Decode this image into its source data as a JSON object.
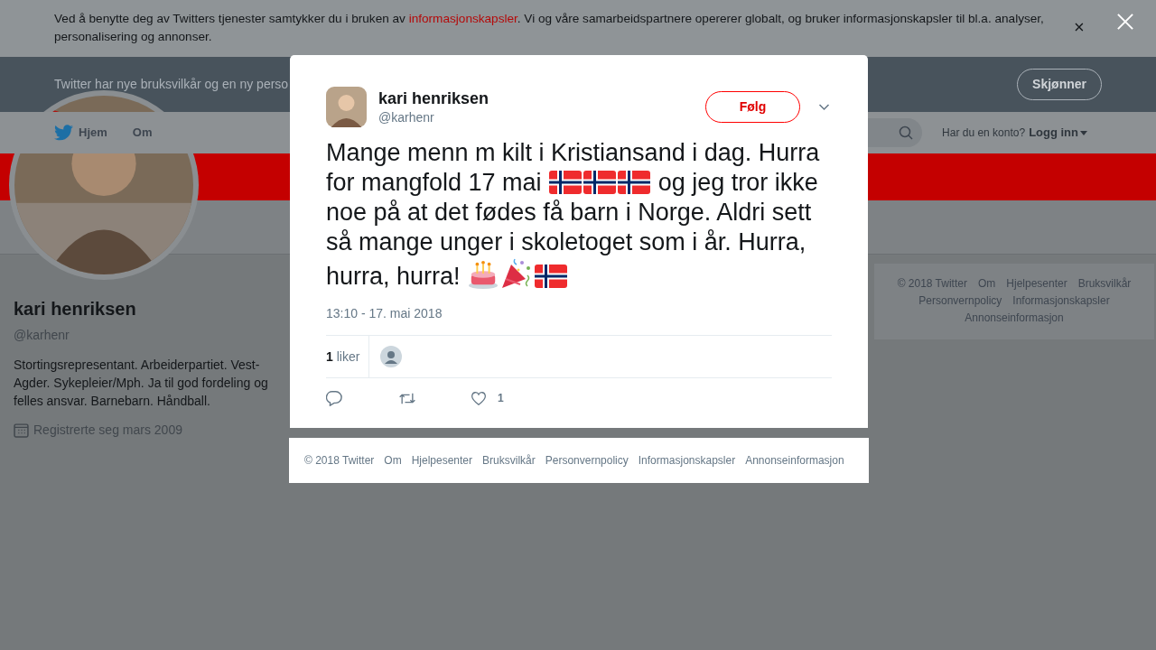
{
  "cookie_banner": {
    "text_before": "Ved å benytte deg av Twitters tjenester samtykker du i bruken av ",
    "link": "informasjonskapsler",
    "text_after": ". Vi og våre samarbeidspartnere opererer globalt, og bruker informasjonskapsler til bl.a. analyser, personalisering og annonser."
  },
  "terms_banner": {
    "text": "Twitter har nye bruksvilkår og en ny perso",
    "button": "Skjønner"
  },
  "nav": {
    "items": [
      "Hjem",
      "Om"
    ],
    "account_prompt": "Har du en konto?",
    "login": "Logg inn"
  },
  "profile": {
    "name": "kari henriksen",
    "handle": "@karhenr",
    "bio": "Stortingsrepresentant. Arbeiderpartiet. Vest-Agder. Sykepleier/Mph. Ja til god fordeling og felles ansvar. Barnebarn. Håndball.",
    "joined": "Registrerte seg mars 2009"
  },
  "side_footer": [
    "© 2018 Twitter",
    "Om",
    "Hjelpesenter",
    "Bruksvilkår",
    "Personvernpolicy",
    "Informasjonskapsler",
    "Annonseinformasjon"
  ],
  "modal": {
    "name": "kari henriksen",
    "handle": "@karhenr",
    "follow": "Følg",
    "tweet": [
      {
        "kind": "text",
        "text": "Mange menn m kilt i Kristiansand i dag. Hurra for mangfold 17 mai "
      },
      {
        "kind": "flag"
      },
      {
        "kind": "flag"
      },
      {
        "kind": "flag"
      },
      {
        "kind": "text",
        "text": " og jeg tror ikke noe på at det fødes få barn i Norge. Aldri sett så mange unger i skoletoget som i år. Hurra, hurra, hurra! "
      },
      {
        "kind": "cake"
      },
      {
        "kind": "party"
      },
      {
        "kind": "flag"
      }
    ],
    "time": "13:10 - 17. mai 2018",
    "likes_count": "1",
    "likes_label": "liker",
    "like_action_count": "1"
  },
  "modal_footer": [
    "© 2018 Twitter",
    "Om",
    "Hjelpesenter",
    "Bruksvilkår",
    "Personvernpolicy",
    "Informasjonskapsler",
    "Annonseinformasjon"
  ]
}
